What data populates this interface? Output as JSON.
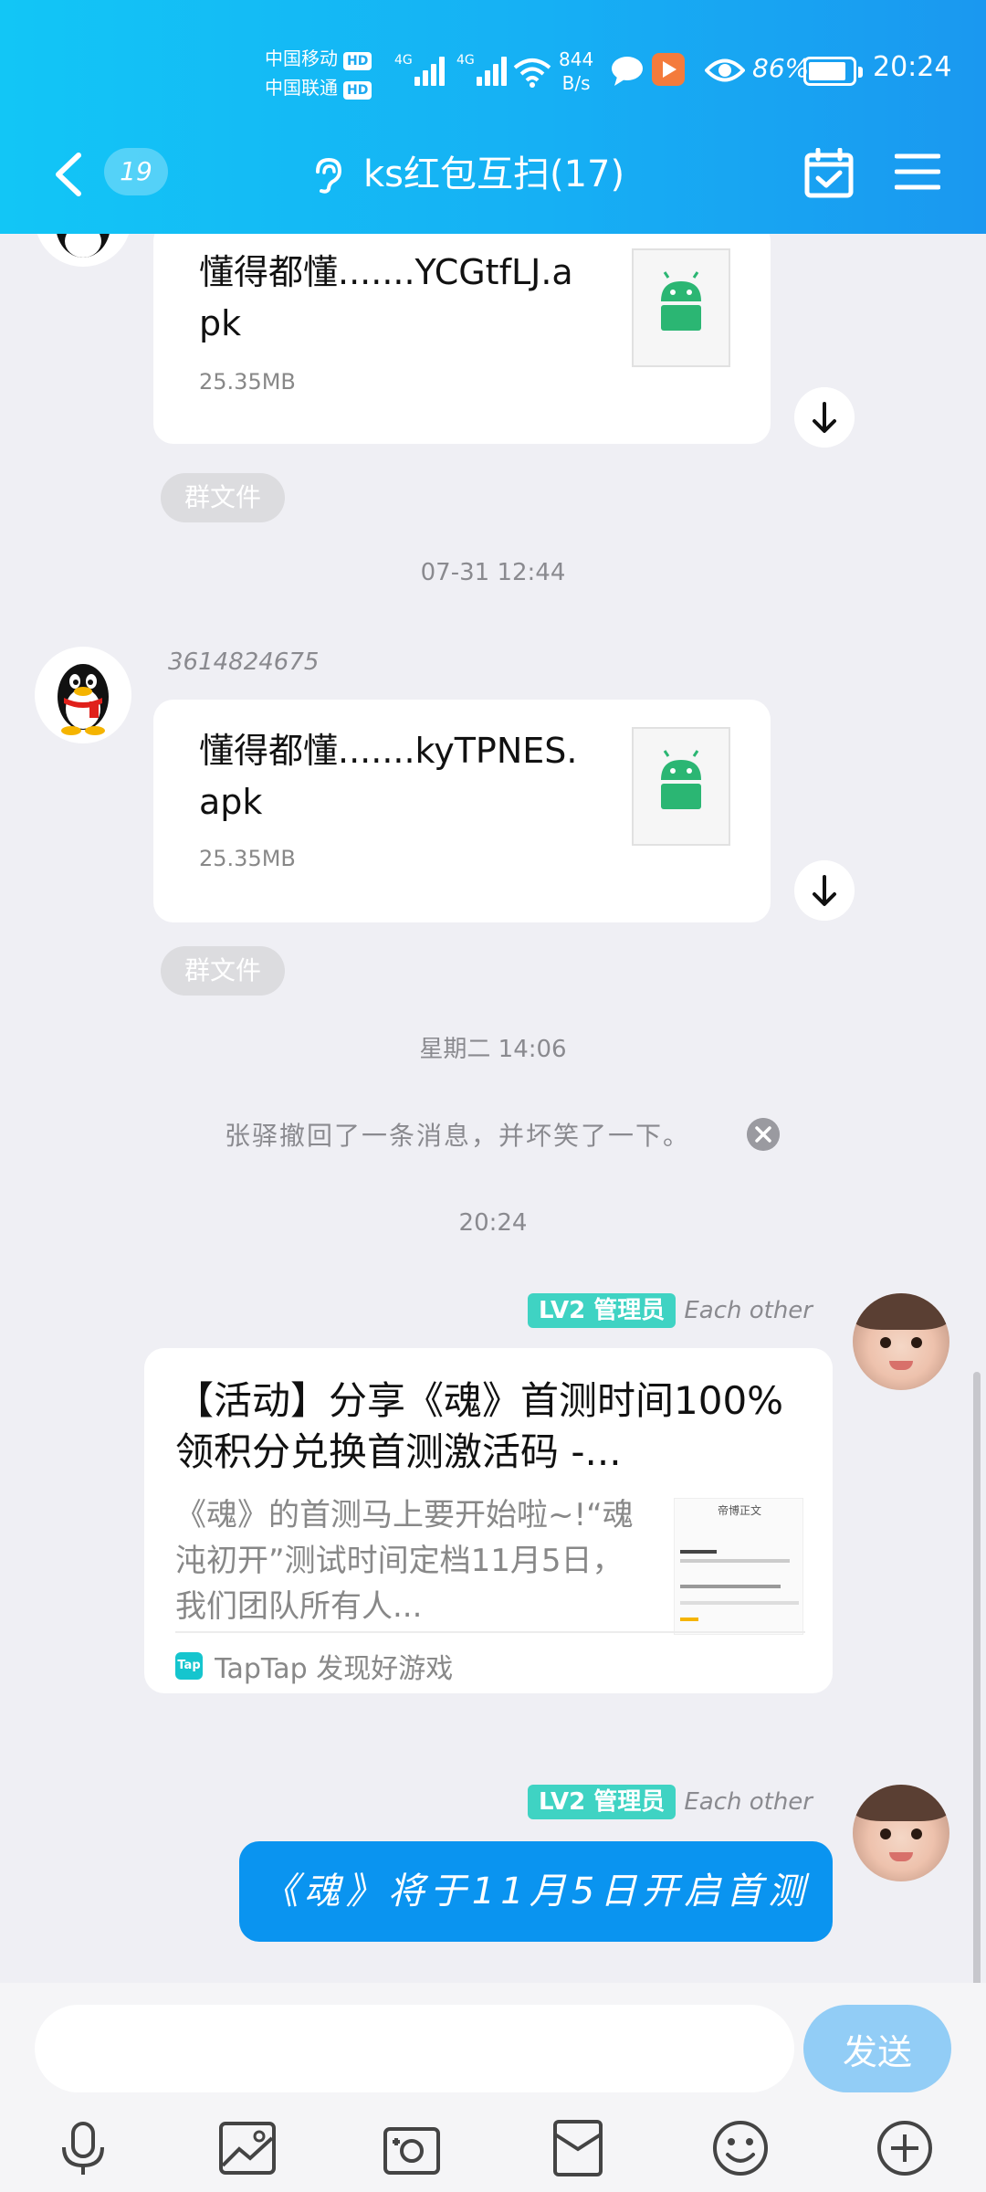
{
  "status_bar": {
    "carrier1": "中国移动",
    "carrier2": "中国联通",
    "hd": "HD",
    "net1": "4G",
    "net2": "4G",
    "speed_value": "844",
    "speed_unit": "B/s",
    "battery": "86%",
    "battery_level": 0.86,
    "time": "20:24"
  },
  "nav": {
    "unread_count": "19",
    "title": "ks红包互扫(17)"
  },
  "messages": {
    "file1": {
      "name": "懂得都懂.......YCGtfLJ.apk",
      "size": "25.35MB",
      "tag": "群文件"
    },
    "time1": "07-31 12:44",
    "sender2": "3614824675",
    "file2": {
      "name": "懂得都懂.......kyTPNES.apk",
      "size": "25.35MB",
      "tag": "群文件"
    },
    "time2": "星期二 14:06",
    "system_msg": "张驿撤回了一条消息，并坏笑了一下。",
    "time3": "20:24",
    "sender3": {
      "badge": "LV2 管理员",
      "name": "Each other"
    },
    "link_card": {
      "title": "【活动】分享《魂》首测时间100%领积分兑换首测激活码 -...",
      "description": "《魂》的首测马上要开始啦~!“魂沌初开”测试时间定档11月5日，我们团队所有人...",
      "source": "TapTap 发现好游戏",
      "logo_text": "Tap",
      "thumb_title": "帝博正文"
    },
    "sender4": {
      "badge": "LV2 管理员",
      "name": "Each other"
    },
    "text_msg": "《魂》将于11月5日开启首测"
  },
  "input": {
    "placeholder": "",
    "send_label": "发送"
  },
  "colors": {
    "header_start": "#12c6f6",
    "header_end": "#1a98f0",
    "bubble_blue": "#0a94f0",
    "badge_teal": "#3fd3c3"
  }
}
